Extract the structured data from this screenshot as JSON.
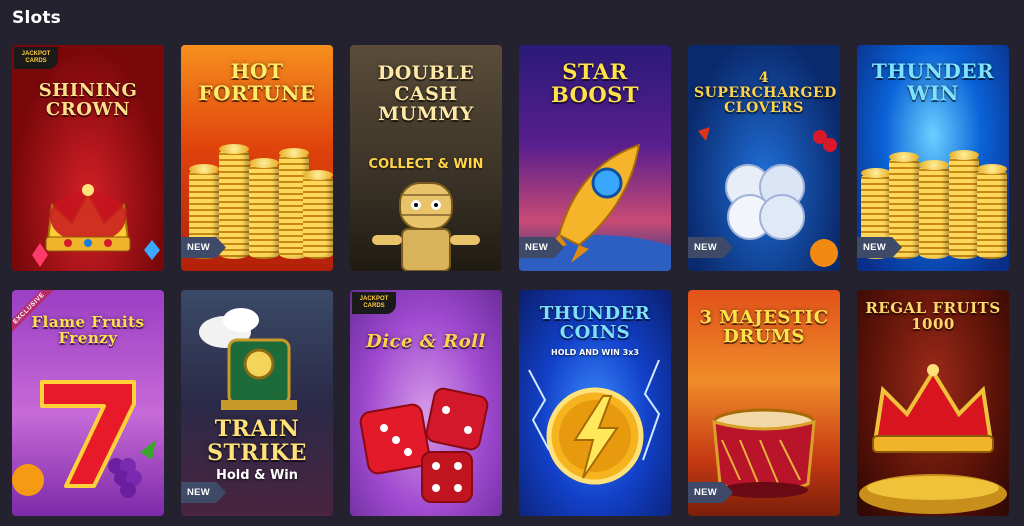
{
  "section": {
    "title": "Slots"
  },
  "games": [
    {
      "title": "Shining Crown",
      "badge": "",
      "logo": "JACKPOT CARDS",
      "icon": "crown-icon",
      "bg": [
        "#a3141a",
        "#5e0507"
      ]
    },
    {
      "title": "Hot Fortune",
      "badge": "NEW",
      "icon": "coins-icon",
      "bg": [
        "#f06a10",
        "#b0260a"
      ]
    },
    {
      "title": "Double Cash Mummy",
      "subtitle": "COLLECT & WIN",
      "badge": "",
      "icon": "mummy-icon",
      "bg": [
        "#4a3f2e",
        "#1f1b15"
      ]
    },
    {
      "title": "Star Boost",
      "badge": "NEW",
      "icon": "rocket-icon",
      "bg": [
        "#3a1d8a",
        "#c23f7a"
      ]
    },
    {
      "title": "4 Supercharged Clovers",
      "badge": "NEW",
      "icon": "clover-icon",
      "bg": [
        "#0d3f9e",
        "#06245a"
      ]
    },
    {
      "title": "Thunder Win",
      "badge": "NEW",
      "icon": "coins-icon",
      "bg": [
        "#0a73e0",
        "#0a2f8a"
      ]
    },
    {
      "title": "Flame Fruits Frenzy",
      "badge": "",
      "ribbon": "EXCLUSIVE",
      "icon": "lucky-seven-icon",
      "bg": [
        "#8a2fb5",
        "#c95fd6"
      ]
    },
    {
      "title": "Train Strike",
      "subtitle": "Hold & Win",
      "badge": "NEW",
      "icon": "train-icon",
      "bg": [
        "#2b3a5a",
        "#3a2238"
      ]
    },
    {
      "title": "Dice & Roll",
      "badge": "",
      "logo": "JACKPOT CARDS",
      "icon": "dice-icon",
      "bg": [
        "#b46bd8",
        "#6b2c9a"
      ]
    },
    {
      "title": "Thunder Coins",
      "subtitle": "HOLD AND WIN 3x3",
      "badge": "",
      "icon": "lightning-coin-icon",
      "bg": [
        "#1240c8",
        "#0b1f6e"
      ]
    },
    {
      "title": "3 Majestic Drums",
      "badge": "NEW",
      "icon": "drum-icon",
      "bg": [
        "#e0661e",
        "#a52d10"
      ]
    },
    {
      "title": "Regal Fruits 1000",
      "badge": "",
      "icon": "crown-icon",
      "bg": [
        "#7a1e12",
        "#3b0b06"
      ]
    }
  ]
}
